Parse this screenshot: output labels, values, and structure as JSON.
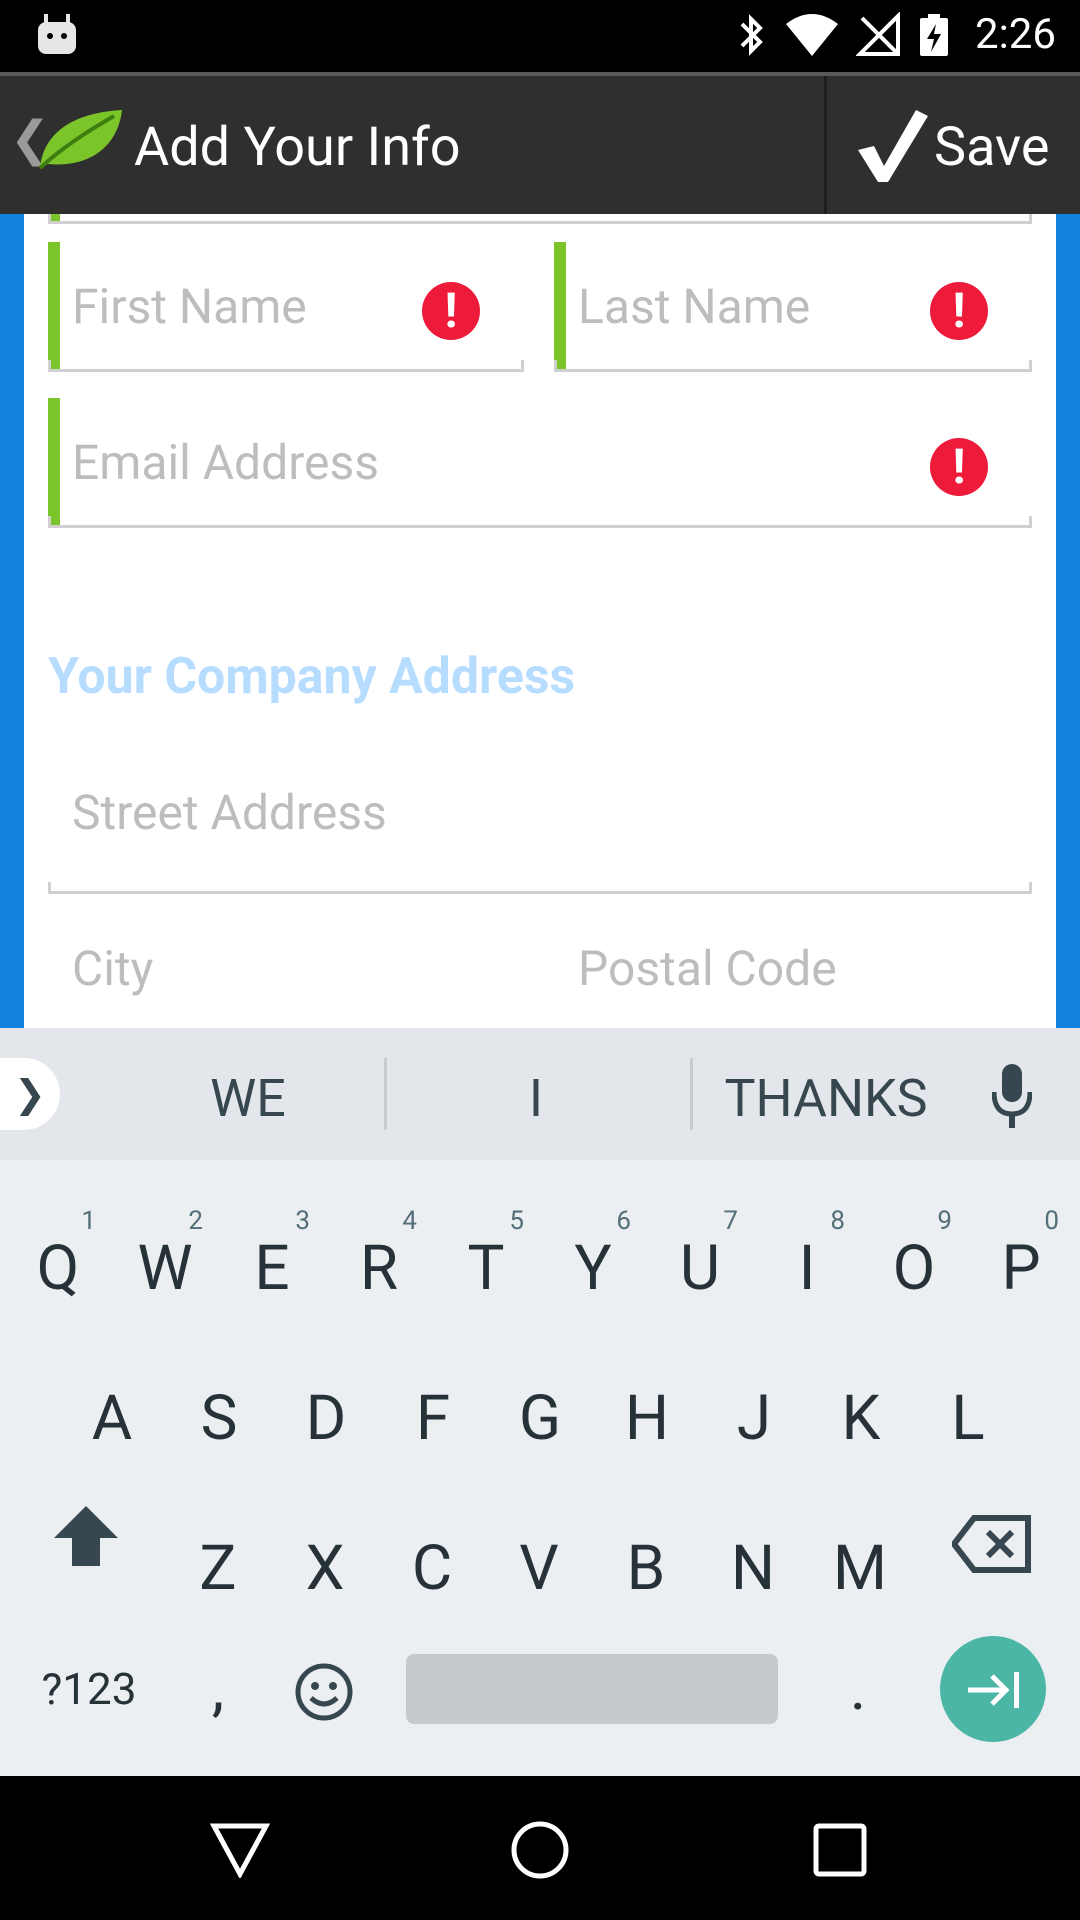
{
  "status_bar": {
    "time": "2:26"
  },
  "app_bar": {
    "title": "Add Your Info",
    "save_label": "Save"
  },
  "personal": {
    "first_name_placeholder": "First Name",
    "last_name_placeholder": "Last Name",
    "email_placeholder": "Email Address",
    "error_glyph": "!"
  },
  "company": {
    "section_title": "Your Company Address",
    "street_placeholder": "Street Address",
    "city_placeholder": "City",
    "postal_placeholder": "Postal Code"
  },
  "keyboard": {
    "suggestions": [
      "WE",
      "I",
      "THANKS"
    ],
    "row1": [
      {
        "k": "Q",
        "h": "1"
      },
      {
        "k": "W",
        "h": "2"
      },
      {
        "k": "E",
        "h": "3"
      },
      {
        "k": "R",
        "h": "4"
      },
      {
        "k": "T",
        "h": "5"
      },
      {
        "k": "Y",
        "h": "6"
      },
      {
        "k": "U",
        "h": "7"
      },
      {
        "k": "I",
        "h": "8"
      },
      {
        "k": "O",
        "h": "9"
      },
      {
        "k": "P",
        "h": "0"
      }
    ],
    "row2": [
      "A",
      "S",
      "D",
      "F",
      "G",
      "H",
      "J",
      "K",
      "L"
    ],
    "row3": [
      "Z",
      "X",
      "C",
      "V",
      "B",
      "N",
      "M"
    ],
    "symbols_label": "?123",
    "comma": ",",
    "period": "."
  },
  "colors": {
    "accent_green": "#7bc52a",
    "error_red": "#ee1a3a",
    "background_blue": "#1282de",
    "enter_teal": "#4cb6a6"
  }
}
